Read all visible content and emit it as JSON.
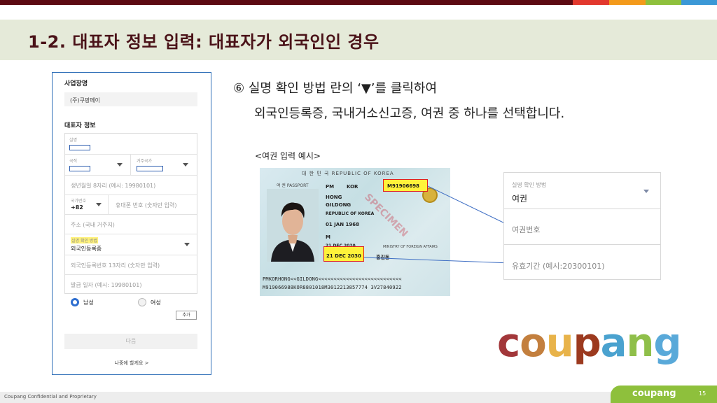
{
  "title": "1-2. 대표자 정보 입력: 대표자가 외국인인 경우",
  "colors": {
    "stripe": [
      "#e2382d",
      "#f39a1b",
      "#8ec03c",
      "#3b98d6"
    ],
    "title": "#4a1218",
    "banner": "#e5ead9"
  },
  "form": {
    "biz_name_label": "사업장명",
    "biz_name_value": "(주)쿠팡페이",
    "rep_section_label": "대표자 정보",
    "name_label": "실명",
    "nationality_label": "국적",
    "residence_country_label": "거주국가",
    "birth_placeholder": "생년월일 8자리 (예시: 19980101)",
    "country_code_label": "국가번호",
    "country_code_value": "+82",
    "phone_placeholder": "휴대폰 번호 (숫자만 입력)",
    "address_placeholder": "주소 (국내 거주지)",
    "verify_method_label": "실명 확인 방법",
    "verify_method_value": "외국인등록증",
    "registration_placeholder": "외국인등록번호 13자리 (숫자만 입력)",
    "issue_date_placeholder": "발급 일자 (예시: 19980101)",
    "gender_male": "남성",
    "gender_female": "여성",
    "add_button": "추가",
    "next_button": "다음",
    "later_link": "나중에 할게요 >"
  },
  "instruction": {
    "line1": "⑥ 실명 확인 방법 란의 ‘▼’를 클릭하여",
    "line2": "외국인등록증, 국내거소신고증, 여권 중 하나를 선택합니다."
  },
  "example_caption": "<여권 입력 예시>",
  "passport": {
    "header": "대 한 민 국   REPUBLIC OF KOREA",
    "doc_label": "여 권  PASSPORT",
    "type": "PM",
    "country": "KOR",
    "passport_no": "M91906698",
    "surname": "HONG",
    "given_name": "GILDONG",
    "nationality": "REPUBLIC OF KOREA",
    "birth": "01 JAN 1968",
    "sex": "M",
    "issue": "21 DEC 2020",
    "expiry": "21 DEC 2030",
    "authority": "MINISTRY OF FOREIGN AFFAIRS",
    "signature": "홍길동",
    "specimen": "SPECIMEN",
    "mrz1": "PMKORHONG<<GILDONG<<<<<<<<<<<<<<<<<<<<<<<<<<<",
    "mrz2": "M919066988KOR8801018M3012213857774 3V27840922"
  },
  "example_form": {
    "verify_label": "실명 확인 방법",
    "verify_value": "여권",
    "passport_no_placeholder": "여권번호",
    "expiry_placeholder": "유효기간 (예시:20300101)"
  },
  "logo": {
    "letters": [
      "c",
      "o",
      "u",
      "p",
      "a",
      "n",
      "g"
    ],
    "colors": [
      "#a2373a",
      "#c37f3e",
      "#e8b34a",
      "#9c3a1f",
      "#4aa2cf",
      "#8fbf4a",
      "#59a9d9"
    ]
  },
  "footer": {
    "confidential": "Coupang Confidential and Proprietary",
    "brand": "coupang",
    "page": "15"
  }
}
